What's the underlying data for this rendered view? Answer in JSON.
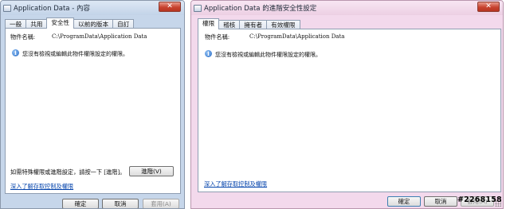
{
  "left_window": {
    "title": "Application Data - 內容",
    "close_label": "✕",
    "tabs": [
      "一般",
      "共用",
      "安全性",
      "以前的版本",
      "自訂"
    ],
    "active_tab": 2,
    "object_name_label": "物件名稱:",
    "object_name_value": "C:\\ProgramData\\Application Data",
    "info_message": "您沒有檢視或編輯此物件權限設定的權限。",
    "advanced_hint": "如需特殊權限或進階設定，請按一下 [進階]。",
    "advanced_button": "進階(V)",
    "learn_link": "深入了解存取控制及權限",
    "ok_button": "確定",
    "cancel_button": "取消",
    "apply_button": "套用(A)"
  },
  "right_window": {
    "title": "Application Data 的進階安全性設定",
    "close_label": "✕",
    "tabs": [
      "權限",
      "稽核",
      "擁有者",
      "有效權限"
    ],
    "active_tab": 0,
    "object_name_label": "物件名稱:",
    "object_name_value": "C:\\ProgramData\\Application Data",
    "info_message": "您沒有檢視或編輯此物件權限設定的權限。",
    "learn_link": "深入了解存取控制及權限",
    "ok_button": "確定",
    "cancel_button": "取消",
    "apply_button": "套用(A)"
  },
  "icons": {
    "info": "info-icon",
    "window": "window-icon",
    "close": "close-icon"
  },
  "watermark": "#2268158"
}
